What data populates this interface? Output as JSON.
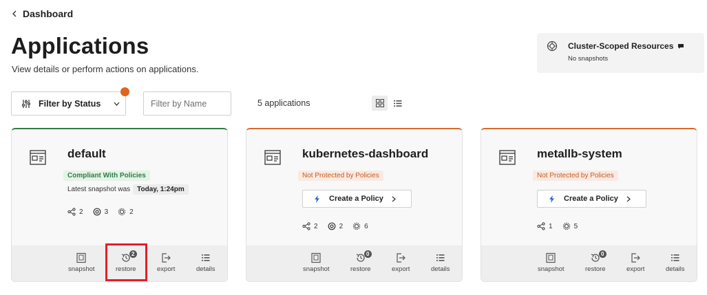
{
  "breadcrumb": {
    "label": "Dashboard"
  },
  "page": {
    "title": "Applications",
    "subtitle": "View details or perform actions on applications."
  },
  "cluster": {
    "title": "Cluster-Scoped Resources",
    "status": "No snapshots"
  },
  "toolbar": {
    "filter_status_label": "Filter by Status",
    "filter_name_placeholder": "Filter by Name",
    "app_count": "5 applications",
    "view_modes": [
      "grid",
      "list"
    ],
    "active_view": "grid"
  },
  "colors": {
    "compliant_accent": "#2e7d43",
    "unprotected_accent": "#d46a2a",
    "filter_dot": "#e0641e",
    "highlight": "#e0202a"
  },
  "cards": [
    {
      "name": "default",
      "badge": "Compliant With Policies",
      "snapshot_prefix": "Latest snapshot was",
      "snapshot_value": "Today, 1:24pm",
      "stats": [
        "2",
        "3",
        "2"
      ],
      "actions": {
        "snapshot": "snapshot",
        "restore": "restore",
        "restore_count": "2",
        "export": "export",
        "details": "details"
      }
    },
    {
      "name": "kubernetes-dashboard",
      "badge": "Not Protected by Policies",
      "policy_button": "Create a Policy",
      "stats": [
        "2",
        "2",
        "6"
      ],
      "actions": {
        "snapshot": "snapshot",
        "restore": "restore",
        "restore_count": "0",
        "export": "export",
        "details": "details"
      }
    },
    {
      "name": "metallb-system",
      "badge": "Not Protected by Policies",
      "policy_button": "Create a Policy",
      "stats": [
        "1",
        "5"
      ],
      "actions": {
        "snapshot": "snapshot",
        "restore": "restore",
        "restore_count": "0",
        "export": "export",
        "details": "details"
      }
    }
  ]
}
